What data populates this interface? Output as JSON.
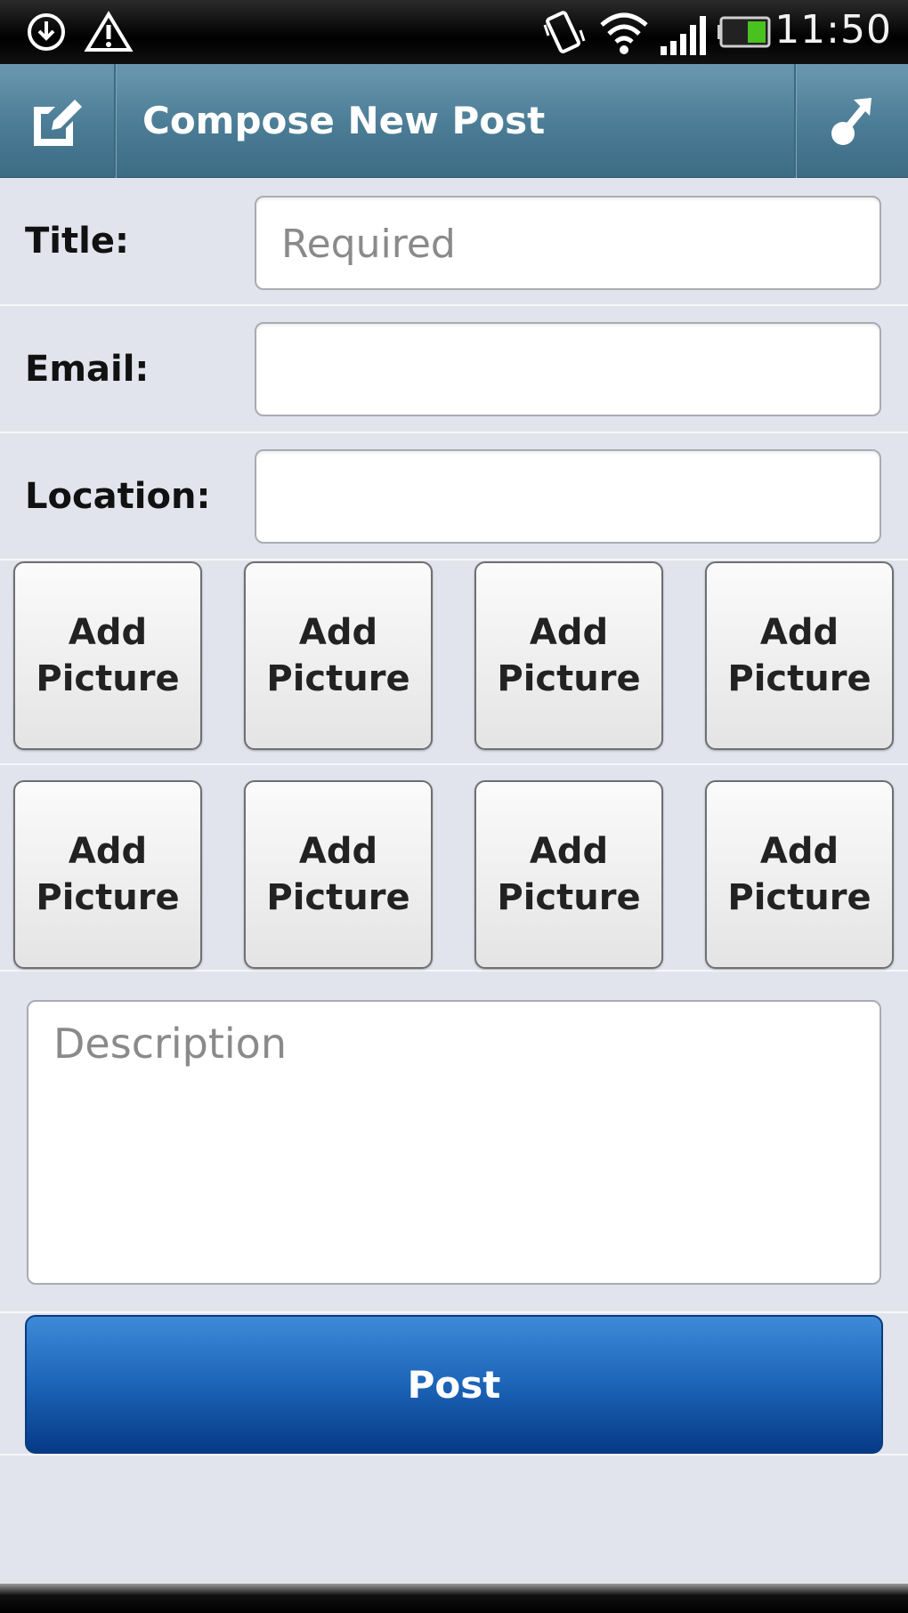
{
  "status_bar": {
    "time": "11:50",
    "icons": [
      "download-icon",
      "alert-icon",
      "vibrate-icon",
      "wifi-icon",
      "signal-icon",
      "battery-icon"
    ]
  },
  "action_bar": {
    "title": "Compose New Post",
    "left_icon": "compose-icon",
    "right_icon": "share-icon"
  },
  "form": {
    "title_label": "Title:",
    "title_placeholder": "Required",
    "email_label": "Email:",
    "location_label": "Location:",
    "picture_buttons": [
      {
        "line1": "Add",
        "line2": "Picture"
      },
      {
        "line1": "Add",
        "line2": "Picture"
      },
      {
        "line1": "Add",
        "line2": "Picture"
      },
      {
        "line1": "Add",
        "line2": "Picture"
      },
      {
        "line1": "Add",
        "line2": "Picture"
      },
      {
        "line1": "Add",
        "line2": "Picture"
      },
      {
        "line1": "Add",
        "line2": "Picture"
      },
      {
        "line1": "Add",
        "line2": "Picture"
      }
    ],
    "description_placeholder": "Description",
    "post_label": "Post"
  },
  "colors": {
    "background": "#e1e4ec",
    "action_bar": "#4b7c95",
    "post_button": "#1c64b8"
  }
}
